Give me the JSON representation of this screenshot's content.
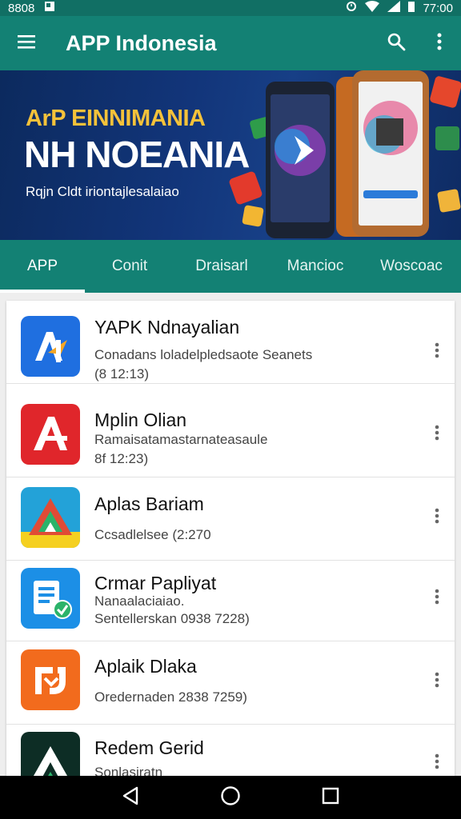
{
  "status_bar": {
    "time_left": "8808",
    "time_right": "77:00"
  },
  "app_bar": {
    "title": "APP Indonesia"
  },
  "banner": {
    "line1": "ArP EINNIMANIA",
    "line2": "NH NOEANIA",
    "line3": "Rqjn Cldt iriontajlesalaiao"
  },
  "tabs": [
    {
      "label": "APP",
      "active": true
    },
    {
      "label": "Conit",
      "active": false
    },
    {
      "label": "Draisarl",
      "active": false
    },
    {
      "label": "Mancioc",
      "active": false
    },
    {
      "label": "Woscoac",
      "active": false
    }
  ],
  "apps": [
    {
      "name": "YAPK Ndnayalian",
      "line1": "Conadans loladelpledsaote Seanets",
      "line2": "(8 12:13)",
      "icon": "a4-logo-icon",
      "color": "#1f6fe0"
    },
    {
      "name": "Mplin Olian",
      "line1": "Ramaisatamastarnateasaule",
      "line2": "8f 12:23)",
      "icon": "a-logo-icon",
      "color": "#e0262b"
    },
    {
      "name": "Aplas Bariam",
      "line1": "Ccsadlelsee (2:270",
      "line2": "",
      "icon": "triangle-logo-icon",
      "color": "#23a2d8"
    },
    {
      "name": "Crmar Papliyat",
      "line1": "Nanaalaciaiao.",
      "line2": "Sentellerskan 0938 7228)",
      "icon": "document-icon",
      "color": "#1c8fe6"
    },
    {
      "name": "Aplaik Dlaka",
      "line1": "Oredernaden 2838 7259)",
      "line2": "",
      "icon": "bracket-logo-icon",
      "color": "#f26b1d"
    },
    {
      "name": "Redem Gerid",
      "line1": "Sonlasiratn",
      "line2": "",
      "icon": "dark-triangle-icon",
      "color": "#0d2d25"
    }
  ]
}
